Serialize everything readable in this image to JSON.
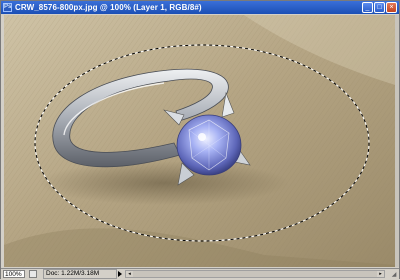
{
  "window": {
    "title": "CRW_8576-800px.jpg @ 100% (Layer 1, RGB/8#)",
    "app_icon_glyph": "Ps",
    "minimize_glyph": "_",
    "maximize_glyph": "□",
    "close_glyph": "×"
  },
  "statusbar": {
    "zoom": "100%",
    "doc_info": "Doc: 1.22M/3.18M",
    "scroll_left_glyph": "◂",
    "scroll_right_glyph": "▸",
    "resize_glyph": "◢"
  },
  "canvas": {
    "subject": "silver solitaire ring with blue gemstone on textured fabric",
    "selection": "elliptical marquee selection (marching ants)"
  },
  "colors": {
    "titlebar": "#1b4fb5",
    "fabric": "#b4a486",
    "band": "#c8cdd4",
    "gem": "#9aa6ee"
  },
  "icons": {
    "app": "photoshop-document-icon",
    "navigator": "navigator-icon"
  }
}
